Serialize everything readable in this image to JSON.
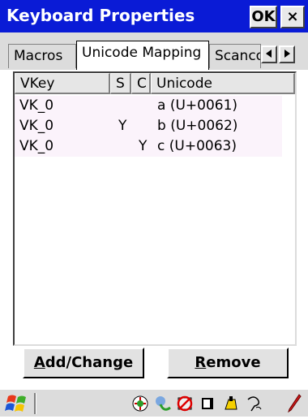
{
  "window": {
    "title": "Keyboard Properties",
    "ok_label": "OK",
    "close_label": "×"
  },
  "tabs": [
    {
      "label": "Macros",
      "active": false
    },
    {
      "label": "Unicode Mapping",
      "active": true
    },
    {
      "label": "Scancode",
      "active": false
    }
  ],
  "tab_scroll": {
    "left": "◄",
    "right": "►"
  },
  "list": {
    "columns": [
      "VKey",
      "S",
      "C",
      "Unicode"
    ],
    "rows": [
      {
        "vkey": "VK_0",
        "s": "",
        "c": "",
        "unicode": "a (U+0061)"
      },
      {
        "vkey": "VK_0",
        "s": "Y",
        "c": "",
        "unicode": "b (U+0062)"
      },
      {
        "vkey": "VK_0",
        "s": "",
        "c": "Y",
        "unicode": "c (U+0063)"
      }
    ]
  },
  "buttons": {
    "add_change": {
      "mnemonic": "A",
      "rest": "dd/Change"
    },
    "remove": {
      "mnemonic": "R",
      "rest": "emove"
    }
  },
  "taskbar": {
    "icons": [
      "windows-start-icon",
      "network-icon",
      "connection-icon",
      "no-signal-icon",
      "battery-icon",
      "keyboard-icon",
      "user-icon",
      "pen-icon"
    ]
  },
  "colors": {
    "title_bar": "#0a1bd6",
    "row_shade": "#fbf3fb"
  }
}
